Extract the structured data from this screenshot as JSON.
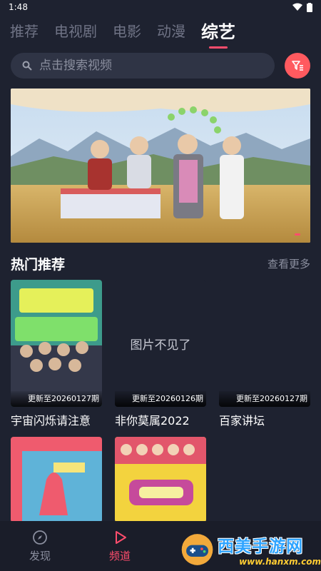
{
  "status_bar": {
    "time": "1:48"
  },
  "tabs": [
    {
      "label": "推荐",
      "active": false
    },
    {
      "label": "电视剧",
      "active": false
    },
    {
      "label": "电影",
      "active": false
    },
    {
      "label": "动漫",
      "active": false
    },
    {
      "label": "综艺",
      "active": true
    }
  ],
  "search": {
    "placeholder": "点击搜索视频",
    "icon": "search-icon"
  },
  "filter_button": {
    "icon": "filter-icon",
    "color": "#ff5a5f"
  },
  "banner": {
    "image": "variety-show-banner"
  },
  "hot_section": {
    "title": "热门推荐",
    "more_label": "查看更多"
  },
  "cards": [
    {
      "title": "宇宙闪烁请注意",
      "update": "更新至20260127期",
      "image_missing": false
    },
    {
      "title": "非你莫属2022",
      "update": "更新至20260126期",
      "image_missing": true,
      "missing_text": "图片不见了"
    },
    {
      "title": "百家讲坛",
      "update": "更新至20260127期",
      "image_missing": true
    },
    {
      "title": "",
      "update": "",
      "image_missing": false
    },
    {
      "title": "",
      "update": "",
      "image_missing": false
    }
  ],
  "bottom_nav": [
    {
      "label": "发现",
      "icon": "compass-icon",
      "active": false
    },
    {
      "label": "频道",
      "icon": "play-icon",
      "active": true
    }
  ],
  "watermark": {
    "title": "西美手游网",
    "url": "www.hanxm.com"
  },
  "colors": {
    "background": "#1e2230",
    "accent": "#ff4d6d",
    "search_bg": "#2f3445"
  }
}
